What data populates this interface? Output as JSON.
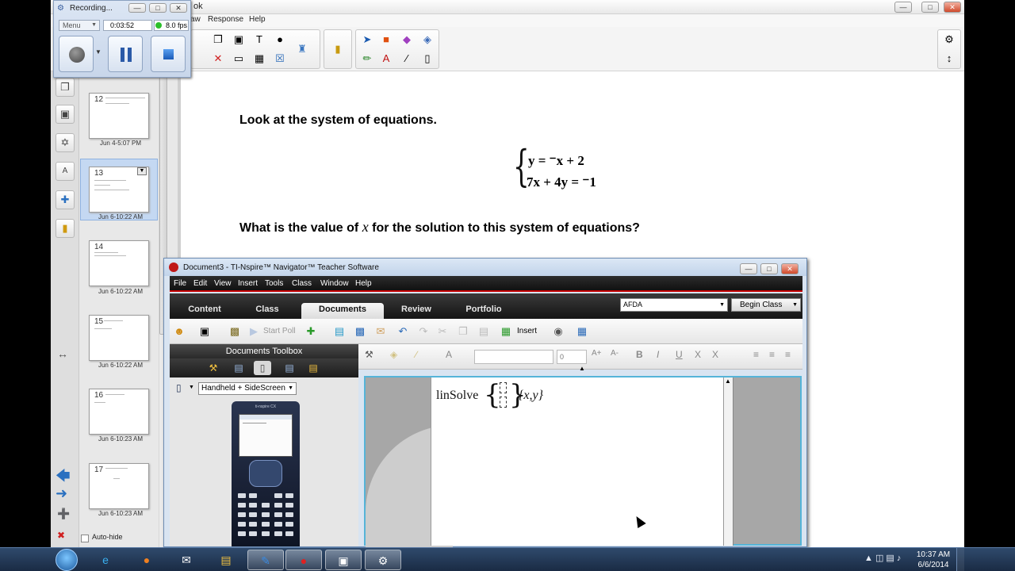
{
  "notebook": {
    "title_fragment": "ok",
    "menu": [
      "aw",
      "Response",
      "Help"
    ],
    "question_1": "Look at the system of equations.",
    "equations": [
      "y = ⁻x + 2",
      "7x + 4y = ⁻1"
    ],
    "question_2_prefix": "What is the value of ",
    "question_2_var": "x",
    "question_2_suffix": " for the solution to this system of equations?"
  },
  "sidebar": {
    "thumbnails": [
      {
        "num": "12",
        "date": "Jun 4-5:07 PM"
      },
      {
        "num": "13",
        "date": "Jun 6-10:22 AM"
      },
      {
        "num": "14",
        "date": "Jun 6-10:22 AM"
      },
      {
        "num": "15",
        "date": "Jun 6-10:22 AM"
      },
      {
        "num": "16",
        "date": "Jun 6-10:23 AM"
      },
      {
        "num": "17",
        "date": "Jun 6-10:23 AM"
      }
    ],
    "autohide_label": "Auto-hide"
  },
  "recorder": {
    "title": "Recording...",
    "menu_label": "Menu",
    "elapsed": "0:03:52",
    "fps": "8.0 fps"
  },
  "ti": {
    "title": "Document3 - TI-Nspire™ Navigator™ Teacher Software",
    "menu": [
      "File",
      "Edit",
      "View",
      "Insert",
      "Tools",
      "Class",
      "Window",
      "Help"
    ],
    "tabs": [
      "Content",
      "Class",
      "Documents",
      "Review",
      "Portfolio"
    ],
    "class_name": "AFDA",
    "begin_class": "Begin Class",
    "start_poll": "Start Poll",
    "insert": "Insert",
    "toolbox_title": "Documents Toolbox",
    "view_mode": "Handheld + SideScreen",
    "handheld_brand": "ti-nspire CX",
    "size_value": "0",
    "expr_func": "linSolve",
    "expr_vars": "{x,y}"
  },
  "taskbar": {
    "time": "10:37 AM",
    "date": "6/6/2014"
  },
  "colors": {
    "accent_red": "#c40000",
    "doc_border": "#55b4d8",
    "selected_thumb": "#c4d8f2"
  }
}
